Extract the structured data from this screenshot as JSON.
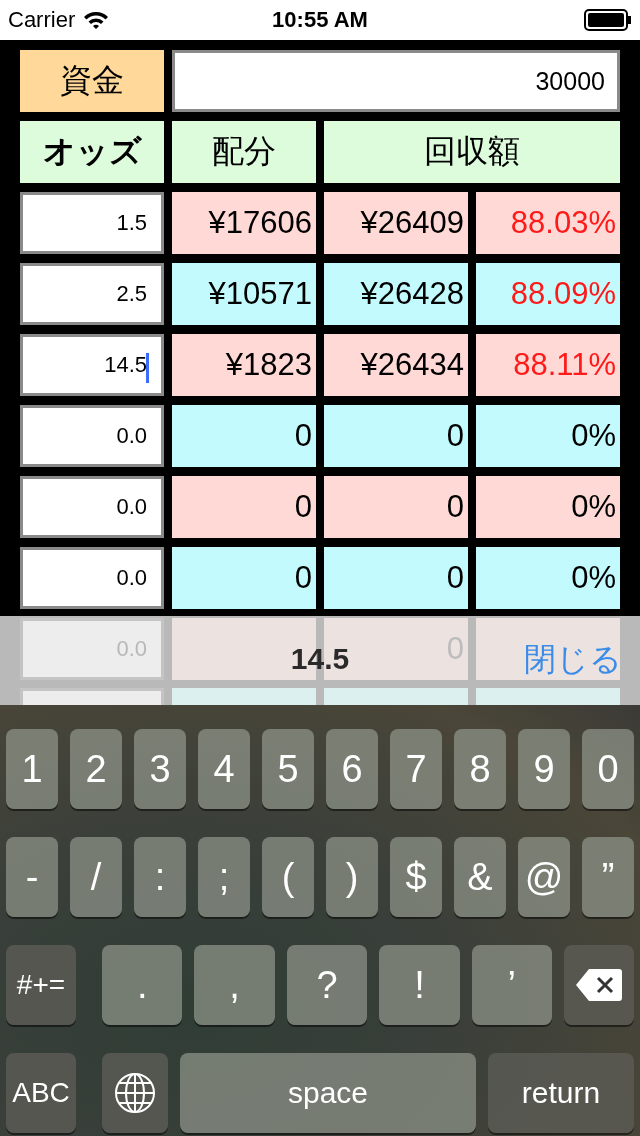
{
  "status_bar": {
    "carrier": "Carrier",
    "time": "10:55 AM"
  },
  "funds": {
    "label": "資金",
    "value": "30000"
  },
  "headers": [
    {
      "label": "オッズ"
    },
    {
      "label": "配分"
    },
    {
      "label": "回収額"
    }
  ],
  "rows": [
    {
      "odds": "1.5",
      "focused": false,
      "color": "#ffd9d5",
      "share": "¥17606",
      "return": "¥26409",
      "rate": "88.03%",
      "alert": true
    },
    {
      "odds": "2.5",
      "focused": false,
      "color": "#c2fafd",
      "share": "¥10571",
      "return": "¥26428",
      "rate": "88.09%",
      "alert": true
    },
    {
      "odds": "14.5",
      "focused": true,
      "color": "#ffd9d5",
      "share": "¥1823",
      "return": "¥26434",
      "rate": "88.11%",
      "alert": true
    },
    {
      "odds": "0.0",
      "focused": false,
      "color": "#c2fafd",
      "share": "0",
      "return": "0",
      "rate": "0%",
      "alert": false
    },
    {
      "odds": "0.0",
      "focused": false,
      "color": "#ffd9d5",
      "share": "0",
      "return": "0",
      "rate": "0%",
      "alert": false
    },
    {
      "odds": "0.0",
      "focused": false,
      "color": "#c2fafd",
      "share": "0",
      "return": "0",
      "rate": "0%",
      "alert": false
    }
  ],
  "accessory_bar": {
    "value": "14.5",
    "close": "閉じる",
    "rows_behind": [
      {
        "odds": "0.0",
        "return": "0",
        "color": "#ece2e0"
      },
      {
        "color": "#dcf0f0"
      }
    ]
  },
  "keyboard": {
    "number_keys": [
      {
        "kind": "char",
        "label": "1"
      },
      {
        "kind": "char",
        "label": "2"
      },
      {
        "kind": "char",
        "label": "3"
      },
      {
        "kind": "char",
        "label": "4"
      },
      {
        "kind": "char",
        "label": "5"
      },
      {
        "kind": "char",
        "label": "6"
      },
      {
        "kind": "char",
        "label": "7"
      },
      {
        "kind": "char",
        "label": "8"
      },
      {
        "kind": "char",
        "label": "9"
      },
      {
        "kind": "char",
        "label": "0"
      }
    ],
    "symbol_keys": [
      {
        "kind": "char",
        "label": "-"
      },
      {
        "kind": "char",
        "label": "/"
      },
      {
        "kind": "char",
        "label": ":"
      },
      {
        "kind": "char",
        "label": ";"
      },
      {
        "kind": "char",
        "label": "("
      },
      {
        "kind": "char",
        "label": ")"
      },
      {
        "kind": "char",
        "label": "$"
      },
      {
        "kind": "char",
        "label": "&"
      },
      {
        "kind": "char",
        "label": "@"
      },
      {
        "kind": "char",
        "label": "”"
      }
    ],
    "punctuation_keys": [
      {
        "kind": "mode",
        "label": "#+="
      },
      {
        "kind": "char",
        "label": "."
      },
      {
        "kind": "char",
        "label": ","
      },
      {
        "kind": "char",
        "label": "?"
      },
      {
        "kind": "char",
        "label": "!"
      },
      {
        "kind": "char",
        "label": "’"
      },
      {
        "kind": "delete"
      }
    ],
    "bottom_keys": [
      {
        "kind": "mode",
        "label": "ABC"
      },
      {
        "kind": "globe"
      },
      {
        "kind": "space",
        "label": "space"
      },
      {
        "kind": "return",
        "label": "return"
      }
    ]
  }
}
